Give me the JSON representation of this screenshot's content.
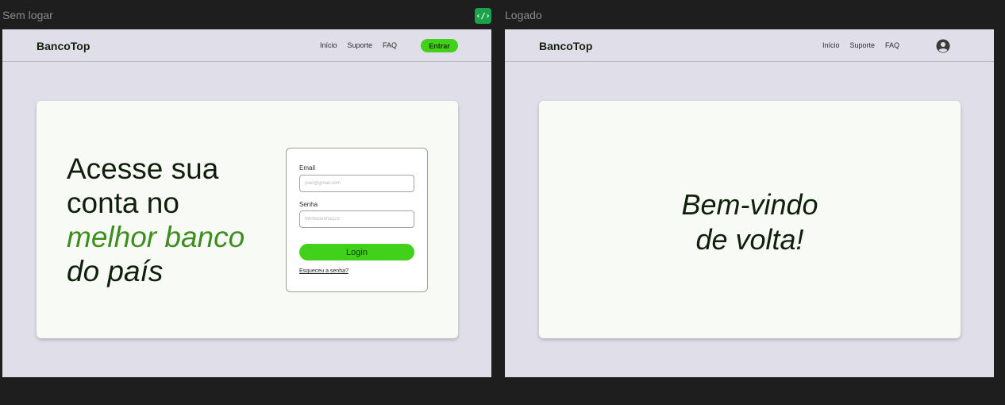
{
  "canvas": {
    "frame_left_label": "Sem logar",
    "frame_right_label": "Logado",
    "code_badge_text": "‹/›"
  },
  "logged_out": {
    "brand": "BancoTop",
    "nav": [
      "Início",
      "Suporte",
      "FAQ"
    ],
    "enter_button": "Entrar",
    "hero": {
      "line1": "Acesse sua",
      "line2": "conta no",
      "line3": "melhor banco",
      "line4": "do país"
    },
    "login_form": {
      "email_label": "Email",
      "email_placeholder": "joao@gmail.com",
      "password_label": "Senha",
      "password_placeholder": "MinhaSenha123",
      "login_button": "Login",
      "forgot_link": "Esqueceu a senha?"
    }
  },
  "logged_in": {
    "brand": "BancoTop",
    "nav": [
      "Início",
      "Suporte",
      "FAQ"
    ],
    "avatar_icon": "user-circle-icon",
    "welcome_line1": "Bem-vindo",
    "welcome_line2": "de volta!"
  },
  "colors": {
    "canvas_bg": "#1e1e1e",
    "frame_bg": "#e0dfe9",
    "card_bg": "#f8faf6",
    "accent_green": "#41d11a",
    "hero_green": "#3e8e1f",
    "text_dark": "#0f1f0b"
  }
}
